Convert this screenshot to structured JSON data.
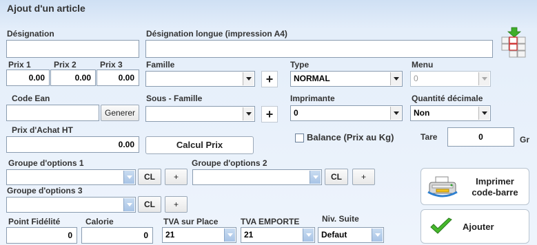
{
  "form": {
    "title": "Ajout d'un article"
  },
  "designation": {
    "label": "Désignation",
    "value": "",
    "long_label": "Désignation longue (impression A4)",
    "long_value": ""
  },
  "prices": {
    "prix1_label": "Prix 1",
    "prix2_label": "Prix 2",
    "prix3_label": "Prix 3",
    "prix1": "0.00",
    "prix2": "0.00",
    "prix3": "0.00"
  },
  "famille": {
    "label": "Famille",
    "value": ""
  },
  "type": {
    "label": "Type",
    "value": "NORMAL"
  },
  "menu": {
    "label": "Menu",
    "value": "0"
  },
  "code_ean": {
    "label": "Code Ean",
    "value": "",
    "generate_label": "Generer"
  },
  "sous_famille": {
    "label": "Sous - Famille",
    "value": ""
  },
  "imprimante": {
    "label": "Imprimante",
    "value": "0"
  },
  "quantite_decimale": {
    "label": "Quantité décimale",
    "value": "Non"
  },
  "prix_achat": {
    "label": "Prix d'Achat HT",
    "value": "0.00",
    "calc_label": "Calcul Prix"
  },
  "balance": {
    "label": "Balance (Prix au Kg)",
    "checked": false
  },
  "tare": {
    "label": "Tare",
    "value": "0",
    "unit": "Gr"
  },
  "options": {
    "group1_label": "Groupe d'options 1",
    "group2_label": "Groupe d'options 2",
    "group3_label": "Groupe d'options 3",
    "group1_value": "",
    "group2_value": "",
    "group3_value": "",
    "cl_label": "CL",
    "plus_label": "+"
  },
  "fidelite": {
    "label": "Point Fidélité",
    "value": "0"
  },
  "calorie": {
    "label": "Calorie",
    "value": "0"
  },
  "tva_place": {
    "label": "TVA sur Place",
    "value": "21"
  },
  "tva_emporte": {
    "label": "TVA EMPORTE",
    "value": "21"
  },
  "niv_suite": {
    "label": "Niv. Suite",
    "value": "Defaut"
  },
  "actions": {
    "print_barcode_label": "Imprimer code-barre",
    "print_barcode_line1": "Imprimer",
    "print_barcode_line2": "code-barre",
    "add_label": "Ajouter"
  },
  "colors": {
    "background": "#e4eefa",
    "field_border": "#8a9cb0",
    "check_green": "#3fae2a"
  },
  "icons": [
    "keyboard-icon",
    "printer-icon",
    "checkmark-icon",
    "dropdown-arrow-icon",
    "plus-icon"
  ]
}
